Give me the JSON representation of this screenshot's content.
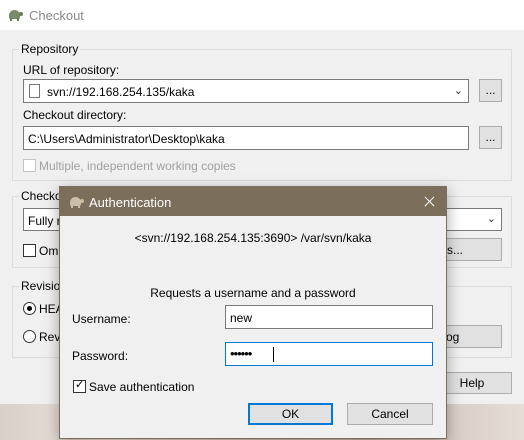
{
  "checkout": {
    "title": "Checkout",
    "repository_group": "Repository",
    "url_label": "URL of repository:",
    "url_value": "svn://192.168.254.135/kaka",
    "browse_button": "...",
    "checkout_dir_label": "Checkout directory:",
    "checkout_dir_value": "C:\\Users\\Administrator\\Desktop\\kaka",
    "multiple_copies_label": "Multiple, independent working copies",
    "checkout_depth_group_partial": "Checko",
    "depth_value_partial": "Fully r",
    "omit_partial": "Om",
    "items_button_partial": "s...",
    "revision_group_partial": "Revisio",
    "head_radio_partial": "HEA",
    "revision_radio_partial": "Rev",
    "show_log_partial": "og",
    "help_button": "Help"
  },
  "auth": {
    "title": "Authentication",
    "realm": "<svn://192.168.254.135:3690> /var/svn/kaka",
    "prompt": "Requests a username and a password",
    "username_label": "Username:",
    "username_value": "new",
    "password_label": "Password:",
    "password_mask": "••••••",
    "save_auth_label": "Save authentication",
    "save_auth_checked": true,
    "ok_button": "OK",
    "cancel_button": "Cancel"
  },
  "colors": {
    "auth_titlebar": "#7b6f5c",
    "focus_border": "#0078d7"
  }
}
